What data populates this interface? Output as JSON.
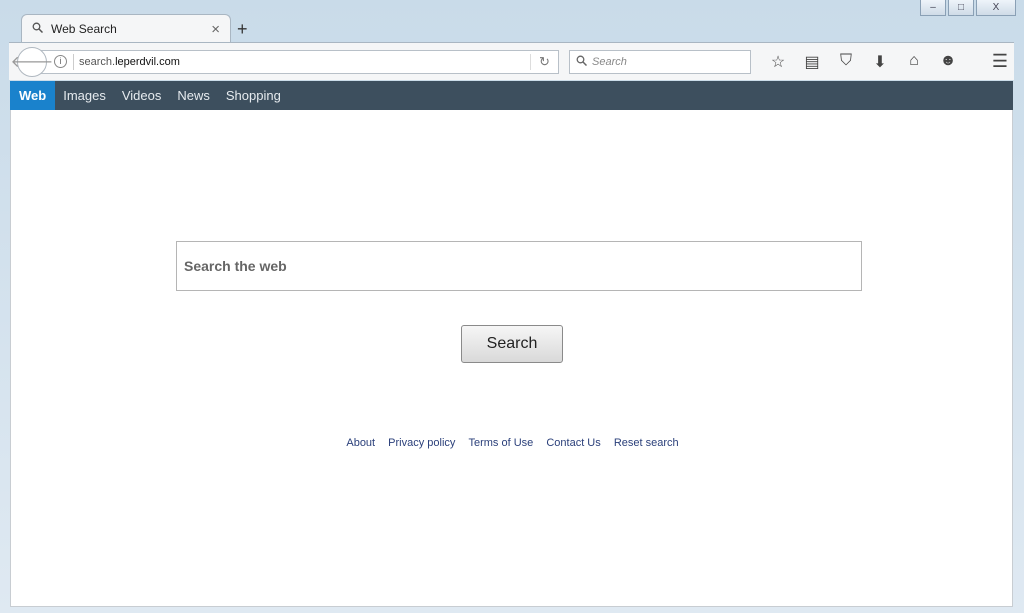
{
  "window": {
    "minimize": "–",
    "maximize": "□",
    "close": "X"
  },
  "tab": {
    "title": "Web Search",
    "close": "×",
    "new_tab": "+"
  },
  "toolbar": {
    "url_prefix": "search.",
    "url_domain": "leperdvil.com",
    "search_placeholder": "Search"
  },
  "nav": {
    "items": [
      {
        "label": "Web",
        "active": true
      },
      {
        "label": "Images"
      },
      {
        "label": "Videos"
      },
      {
        "label": "News"
      },
      {
        "label": "Shopping"
      }
    ],
    "accent": "#1a82cc",
    "bar_color": "#3d4f5e"
  },
  "main": {
    "search_placeholder": "Search the web",
    "search_button": "Search"
  },
  "footer": {
    "links": [
      "About",
      "Privacy policy",
      "Terms of Use",
      "Contact Us",
      "Reset search"
    ]
  }
}
